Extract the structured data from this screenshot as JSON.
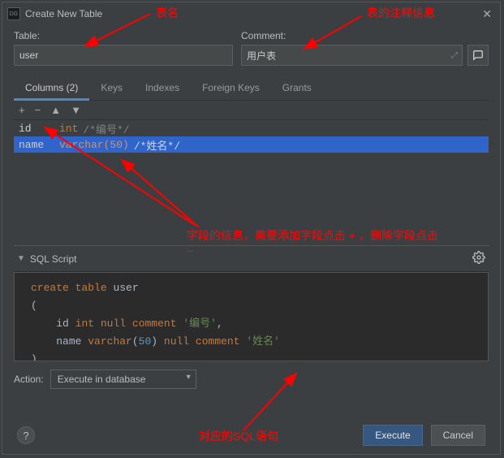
{
  "titlebar": {
    "app_icon_text": "DG",
    "title": "Create New Table"
  },
  "fields": {
    "table_label": "Table:",
    "table_value": "user",
    "comment_label": "Comment:",
    "comment_value": "用户表"
  },
  "tabs": {
    "columns": "Columns (2)",
    "keys": "Keys",
    "indexes": "Indexes",
    "foreign_keys": "Foreign Keys",
    "grants": "Grants"
  },
  "toolbar": {
    "add": "+",
    "remove": "−",
    "up": "▲",
    "down": "▼"
  },
  "columns": [
    {
      "name": "id",
      "type": "int",
      "comment": "/*编号*/"
    },
    {
      "name": "name",
      "type": "varchar(50)",
      "comment": "/*姓名*/"
    }
  ],
  "sql": {
    "header": "SQL Script",
    "kw_create": "create table",
    "ident_user": "user",
    "paren_open": "(",
    "line1_id": "id",
    "line1_int": "int",
    "line1_null": "null",
    "line1_comment_kw": "comment",
    "line1_comment_val": "'编号'",
    "line2_name": "name",
    "line2_type": "varchar",
    "line2_args": "50",
    "line2_null": "null",
    "line2_comment_kw": "comment",
    "line2_comment_val": "'姓名'",
    "paren_close": ")"
  },
  "action": {
    "label": "Action:",
    "value": "Execute in database"
  },
  "buttons": {
    "execute": "Execute",
    "cancel": "Cancel"
  },
  "annotations": {
    "a1": "表名",
    "a2": "表的注释信息",
    "a3": "字段的信息，需要添加字段点击 + ，删除字段点击 –",
    "a4": "对应的SQL语句"
  }
}
